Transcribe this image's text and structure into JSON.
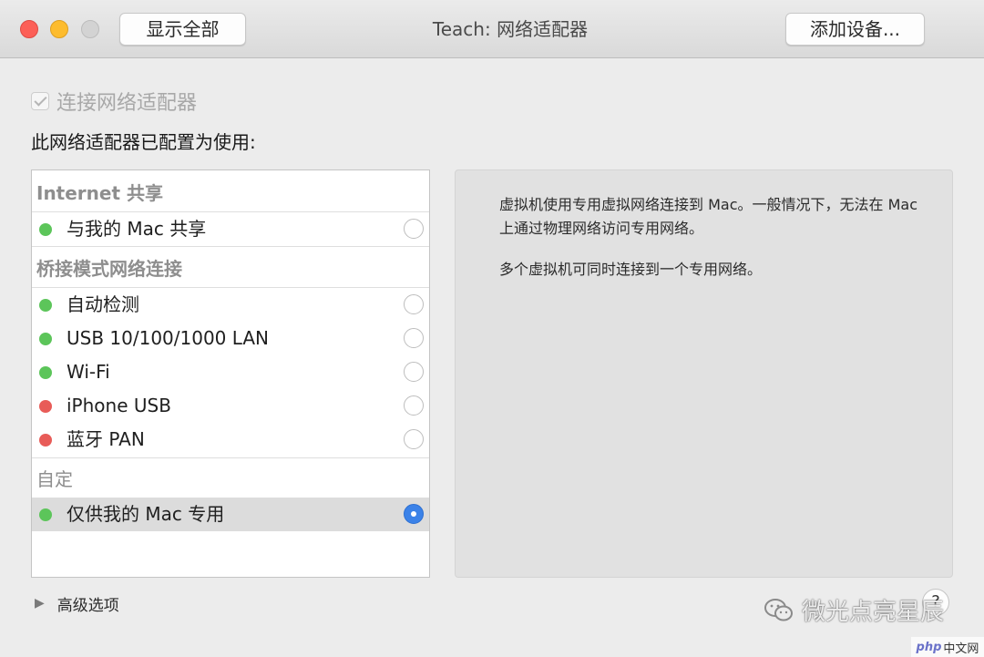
{
  "window": {
    "title": "Teach: 网络适配器",
    "show_all_label": "显示全部",
    "add_device_label": "添加设备..."
  },
  "connect": {
    "label": "连接网络适配器",
    "checked": true,
    "enabled": false
  },
  "configured_label": "此网络适配器已配置为使用:",
  "list": {
    "sections": [
      {
        "header": "Internet 共享",
        "items": [
          {
            "label": "与我的 Mac 共享",
            "status": "green",
            "selected": false
          }
        ]
      },
      {
        "header": "桥接模式网络连接",
        "items": [
          {
            "label": "自动检测",
            "status": "green",
            "selected": false
          },
          {
            "label": "USB 10/100/1000 LAN",
            "status": "green",
            "selected": false
          },
          {
            "label": "Wi-Fi",
            "status": "green",
            "selected": false
          },
          {
            "label": "iPhone USB",
            "status": "red",
            "selected": false
          },
          {
            "label": "蓝牙 PAN",
            "status": "red",
            "selected": false
          }
        ]
      },
      {
        "header": "自定",
        "items": [
          {
            "label": "仅供我的 Mac 专用",
            "status": "green",
            "selected": true
          }
        ]
      }
    ]
  },
  "description": {
    "para1": "虚拟机使用专用虚拟网络连接到 Mac。一般情况下，无法在 Mac 上通过物理网络访问专用网络。",
    "para2": "多个虚拟机可同时连接到一个专用网络。"
  },
  "advanced_label": "高级选项",
  "help_label": "?",
  "watermark": {
    "text": "微光点亮星辰",
    "corner_brand": "php",
    "corner_site": "中文网"
  },
  "colors": {
    "status_green": "#5cc55a",
    "status_red": "#e85c58",
    "accent_blue": "#3b82e8"
  }
}
